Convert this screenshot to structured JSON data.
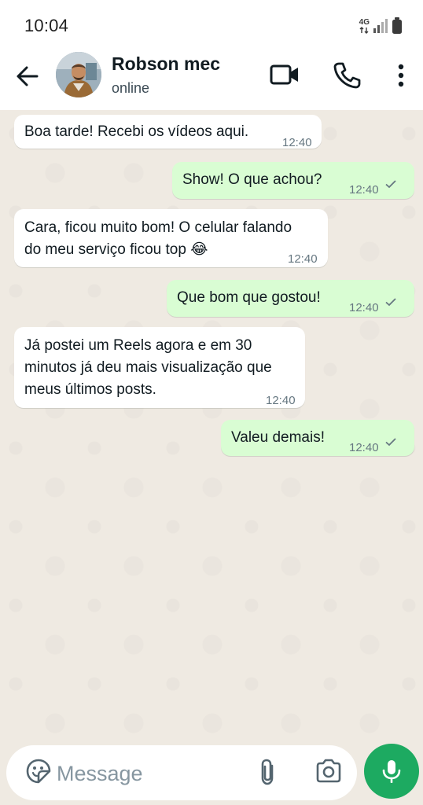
{
  "status_bar": {
    "time": "10:04",
    "network": "4G"
  },
  "header": {
    "contact_name": "Robson mec",
    "contact_status": "online"
  },
  "messages": [
    {
      "direction": "in",
      "text_lines": [
        "Boa tarde! Recebi os vídeos aqui."
      ],
      "time": "12:40"
    },
    {
      "direction": "out",
      "text_lines": [
        "Show! O que achou?"
      ],
      "time": "12:40",
      "status": "sent"
    },
    {
      "direction": "in",
      "text_lines": [
        "Cara, ficou muito bom! O celular falando",
        "do meu serviço ficou top 😂"
      ],
      "time": "12:40"
    },
    {
      "direction": "out",
      "text_lines": [
        "Que bom que gostou!"
      ],
      "time": "12:40",
      "status": "sent"
    },
    {
      "direction": "in",
      "text_lines": [
        "Já postei um Reels agora e em 30",
        "minutos já deu mais visualização que",
        "meus últimos posts."
      ],
      "time": "12:40"
    },
    {
      "direction": "out",
      "text_lines": [
        "Valeu demais!"
      ],
      "time": "12:40",
      "status": "sent"
    }
  ],
  "composer": {
    "placeholder": "Message"
  },
  "icons": {
    "back": "arrow-left-icon",
    "video": "video-camera-icon",
    "call": "phone-icon",
    "more": "more-vertical-icon",
    "emoji": "sticker-emoji-icon",
    "attach": "paperclip-icon",
    "camera": "camera-icon",
    "mic": "microphone-icon",
    "tick": "single-check-icon"
  },
  "colors": {
    "incoming_bubble": "#ffffff",
    "outgoing_bubble": "#d9fdd3",
    "chat_background": "#efeae2",
    "mic_button": "#1daa61",
    "timestamp": "#667781"
  }
}
